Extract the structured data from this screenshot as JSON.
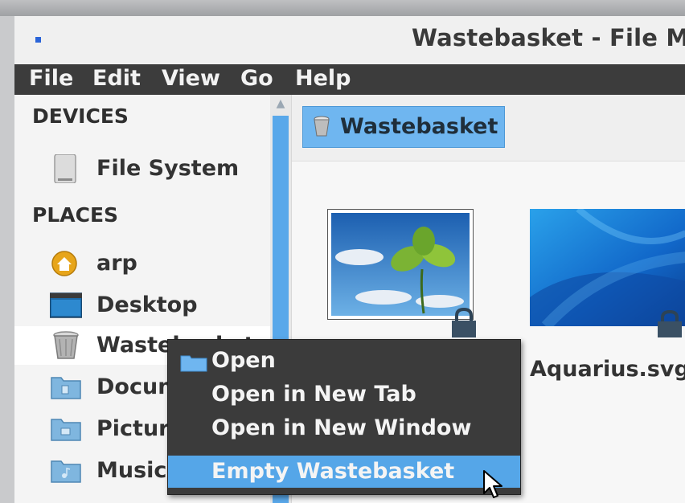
{
  "window": {
    "title": "Wastebasket - File Ma",
    "icon": "app-icon"
  },
  "menubar": {
    "items": [
      "File",
      "Edit",
      "View",
      "Go",
      "Help"
    ]
  },
  "sidebar": {
    "sections": [
      {
        "label": "DEVICES"
      },
      {
        "label": "PLACES"
      }
    ],
    "items": [
      {
        "label": "File System",
        "icon": "drive-icon"
      },
      {
        "label": "arp",
        "icon": "home-icon"
      },
      {
        "label": "Desktop",
        "icon": "desktop-icon"
      },
      {
        "label": "Wastebasket",
        "icon": "trash-icon",
        "selected": true
      },
      {
        "label": "Documents",
        "icon": "folder-documents-icon"
      },
      {
        "label": "Pictures",
        "icon": "folder-pictures-icon"
      },
      {
        "label": "Music",
        "icon": "folder-music-icon"
      }
    ]
  },
  "pathbar": {
    "current": "Wastebasket",
    "icon": "trash-icon"
  },
  "files": [
    {
      "name": "",
      "icon": "image-thumbnail",
      "locked": true
    },
    {
      "name": "Aquarius.svg",
      "icon": "image-thumbnail",
      "locked": true
    }
  ],
  "context_menu": {
    "items": [
      {
        "label": "Open",
        "icon": "folder-icon"
      },
      {
        "label": "Open in New Tab"
      },
      {
        "label": "Open in New Window"
      },
      {
        "label": "Empty Wastebasket",
        "highlighted": true
      }
    ]
  },
  "colors": {
    "accent": "#59a8ea",
    "menubar": "#3c3c3c",
    "context_menu": "#3b3b3b"
  }
}
